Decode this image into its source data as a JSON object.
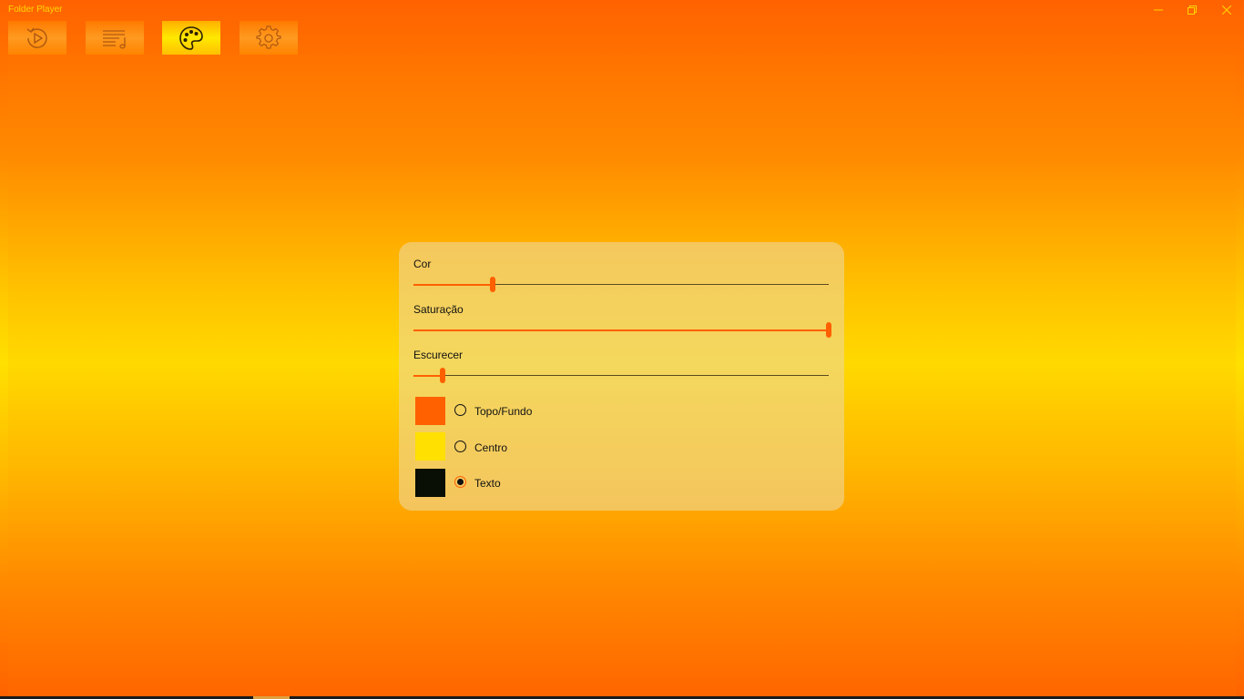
{
  "app": {
    "title": "Folder Player"
  },
  "window_controls": {
    "minimize": "minimize-icon",
    "restore": "restore-icon",
    "close": "close-icon"
  },
  "nav": {
    "active_index": 2,
    "buttons": [
      {
        "icon": "replay-icon"
      },
      {
        "icon": "playlist-icon"
      },
      {
        "icon": "palette-icon"
      },
      {
        "icon": "gear-icon"
      }
    ]
  },
  "colors": {
    "accent": "#ff6000",
    "top_bottom": "#ff6000",
    "center": "#ffe000",
    "text": "#0a0f05"
  },
  "panel": {
    "sliders": [
      {
        "label": "Cor",
        "value": 0.19
      },
      {
        "label": "Saturação",
        "value": 1.0
      },
      {
        "label": "Escurecer",
        "value": 0.07
      }
    ],
    "options": [
      {
        "label": "Topo/Fundo",
        "color": "#ff6000",
        "checked": false
      },
      {
        "label": "Centro",
        "color": "#ffe000",
        "checked": false
      },
      {
        "label": "Texto",
        "color": "#0a0f05",
        "checked": true
      }
    ]
  }
}
